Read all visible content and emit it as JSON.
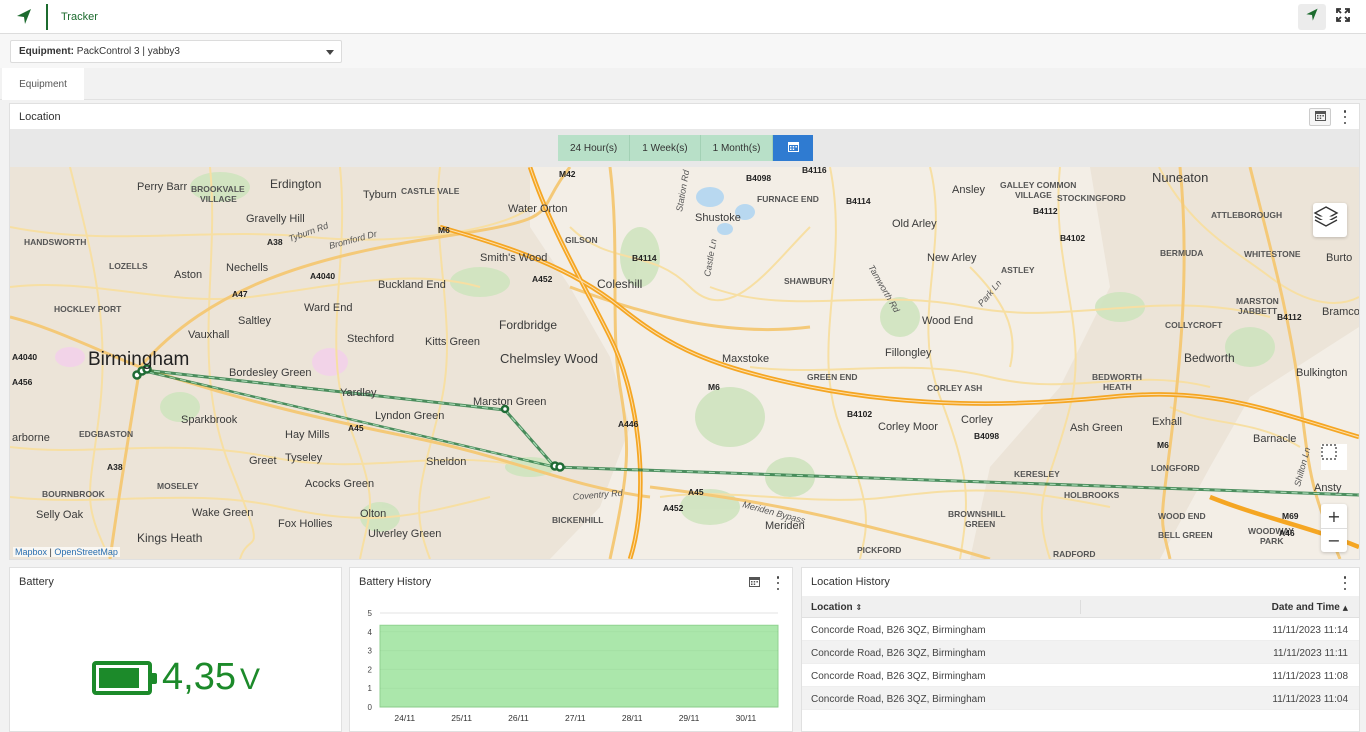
{
  "topbar": {
    "app_title": "Tracker",
    "icons": [
      "navigation-arrow-icon",
      "expand-icon"
    ]
  },
  "equipment": {
    "label": "Equipment:",
    "value": "PackControl 3 | yabby3"
  },
  "tabs": [
    {
      "label": "Equipment"
    }
  ],
  "location": {
    "title": "Location",
    "periods": [
      "24 Hour(s)",
      "1 Week(s)",
      "1 Month(s)"
    ],
    "attribution": {
      "mapbox": "Mapbox",
      "separator": "|",
      "osm": "OpenStreetMap"
    },
    "zoom_in": "+",
    "zoom_out": "−",
    "place_labels": {
      "birmingham": "Birmingham",
      "perry_barr": "Perry Barr",
      "brookvale": "BROOKVALE",
      "village": "VILLAGE",
      "erdington": "Erdington",
      "tyburn": "Tyburn",
      "castle_vale": "CASTLE VALE",
      "water_orton": "Water Orton",
      "gravelly_hill": "Gravelly Hill",
      "handsworth": "HANDSWORTH",
      "lozells": "LOZELLS",
      "aston": "Aston",
      "nechells": "Nechells",
      "hockley_port": "HOCKLEY PORT",
      "saltley": "Saltley",
      "ward_end": "Ward End",
      "vauxhall": "Vauxhall",
      "buckland_end": "Buckland End",
      "smiths_wood": "Smith's Wood",
      "gilson": "GILSON",
      "coleshill": "Coleshill",
      "fordbridge": "Fordbridge",
      "kitts_green": "Kitts Green",
      "stechford": "Stechford",
      "chelmsley_wood": "Chelmsley Wood",
      "bordesley_green": "Bordesley Green",
      "yardley": "Yardley",
      "marston_green": "Marston Green",
      "lyndon_green": "Lyndon Green",
      "sparkbrook": "Sparkbrook",
      "hay_mills": "Hay Mills",
      "edgbaston": "EDGBASTON",
      "tyseley": "Tyseley",
      "greet": "Greet",
      "sheldon": "Sheldon",
      "acocks_green": "Acocks Green",
      "moseley": "MOSELEY",
      "bournbrook": "BOURNBROOK",
      "selly_oak": "Selly Oak",
      "wake_green": "Wake Green",
      "fox_hollies": "Fox Hollies",
      "olton": "Olton",
      "kings_heath": "Kings Heath",
      "ulverley_green": "Ulverley Green",
      "bickenhill": "BICKENHILL",
      "coventry_rd": "Coventry Rd",
      "meriden_bypass": "Meriden Bypass",
      "meriden": "Meriden",
      "shustoke": "Shustoke",
      "furnace_end": "FURNACE END",
      "shawbury": "SHAWBURY",
      "maxstoke": "Maxstoke",
      "green_end": "GREEN END",
      "fillongley": "Fillongley",
      "wood_end": "Wood End",
      "new_arley": "New Arley",
      "old_arley": "Old Arley",
      "ansley": "Ansley",
      "galley_common": "GALLEY COMMON",
      "village2": "VILLAGE",
      "nuneaton": "Nuneaton",
      "stockingford": "STOCKINGFORD",
      "attleborough": "ATTLEBOROUGH",
      "bermuda": "BERMUDA",
      "whitestone": "WHITESTONE",
      "astley": "ASTLEY",
      "collycroft": "COLLYCROFT",
      "marston_jabbett": "MARSTON",
      "jabbett": "JABBETT",
      "bedworth": "Bedworth",
      "bulkington": "Bulkington",
      "bedworth_heath": "BEDWORTH",
      "heath": "HEATH",
      "corley_ash": "CORLEY ASH",
      "corley": "Corley",
      "corley_moor": "Corley Moor",
      "exhall": "Exhall",
      "ash_green": "Ash Green",
      "barnacle": "Barnacle",
      "keresley": "KERESLEY",
      "longford": "LONGFORD",
      "holbrooks": "HOLBROOKS",
      "ansty": "Ansty",
      "brownshill": "BROWNSHILL",
      "green": "GREEN",
      "wood_end2": "WOOD END",
      "bell_green": "BELL GREEN",
      "woodway": "WOODWAY",
      "park": "PARK",
      "radford": "RADFORD",
      "pickford": "PICKFORD",
      "bramco": "Bramco",
      "burto": "Burto",
      "arborne": "arborne",
      "shilton_ln": "Shilton Ln",
      "castle_ln": "Castle Ln",
      "station_rd": "Station Rd",
      "tamworth_rd": "Tamworth Rd",
      "park_ln": "Park Ln",
      "bromford_dr": "Bromford Dr",
      "tyburn_rd": "Tyburn Rd"
    },
    "road_labels": {
      "m42": "M42",
      "m6a": "M6",
      "m6b": "M6",
      "m6c": "M6",
      "m69": "M69",
      "a38a": "A38",
      "a38b": "A38",
      "a4040a": "A4040",
      "a4040b": "A4040",
      "a47": "A47",
      "a456": "A456",
      "a452a": "A452",
      "a452b": "A452",
      "a45a": "A45",
      "a45b": "A45",
      "a446": "A446",
      "a46": "A46",
      "b4114a": "B4114",
      "b4114b": "B4114",
      "b4098a": "B4098",
      "b4098b": "B4098",
      "b4116": "B4116",
      "b4112a": "B4112",
      "b4112b": "B4112",
      "b4102a": "B4102",
      "b4102b": "B4102"
    }
  },
  "battery": {
    "title": "Battery",
    "value": "4,35",
    "unit": "V",
    "color": "#1c8a2a"
  },
  "battery_history": {
    "title": "Battery History",
    "chart_data": {
      "type": "area",
      "x": [
        "24/11",
        "25/11",
        "26/11",
        "27/11",
        "28/11",
        "29/11",
        "30/11"
      ],
      "values": [
        4.35,
        4.35,
        4.35,
        4.35,
        4.35,
        4.35,
        4.35
      ],
      "ylim": [
        0,
        5
      ],
      "yticks": [
        0,
        1,
        2,
        3,
        4,
        5
      ],
      "color": "#90e090",
      "grid": true
    }
  },
  "location_history": {
    "title": "Location History",
    "columns": [
      "Location",
      "Date and Time"
    ],
    "rows": [
      {
        "location": "Concorde Road, B26 3QZ, Birmingham",
        "datetime": "11/11/2023 11:14"
      },
      {
        "location": "Concorde Road, B26 3QZ, Birmingham",
        "datetime": "11/11/2023 11:11"
      },
      {
        "location": "Concorde Road, B26 3QZ, Birmingham",
        "datetime": "11/11/2023 11:08"
      },
      {
        "location": "Concorde Road, B26 3QZ, Birmingham",
        "datetime": "11/11/2023 11:04"
      }
    ]
  },
  "colors": {
    "brand": "#1c6b2e",
    "period_active": "#2f7bd1",
    "period_btn": "#b8e0c8",
    "track": "#2e7d46"
  }
}
